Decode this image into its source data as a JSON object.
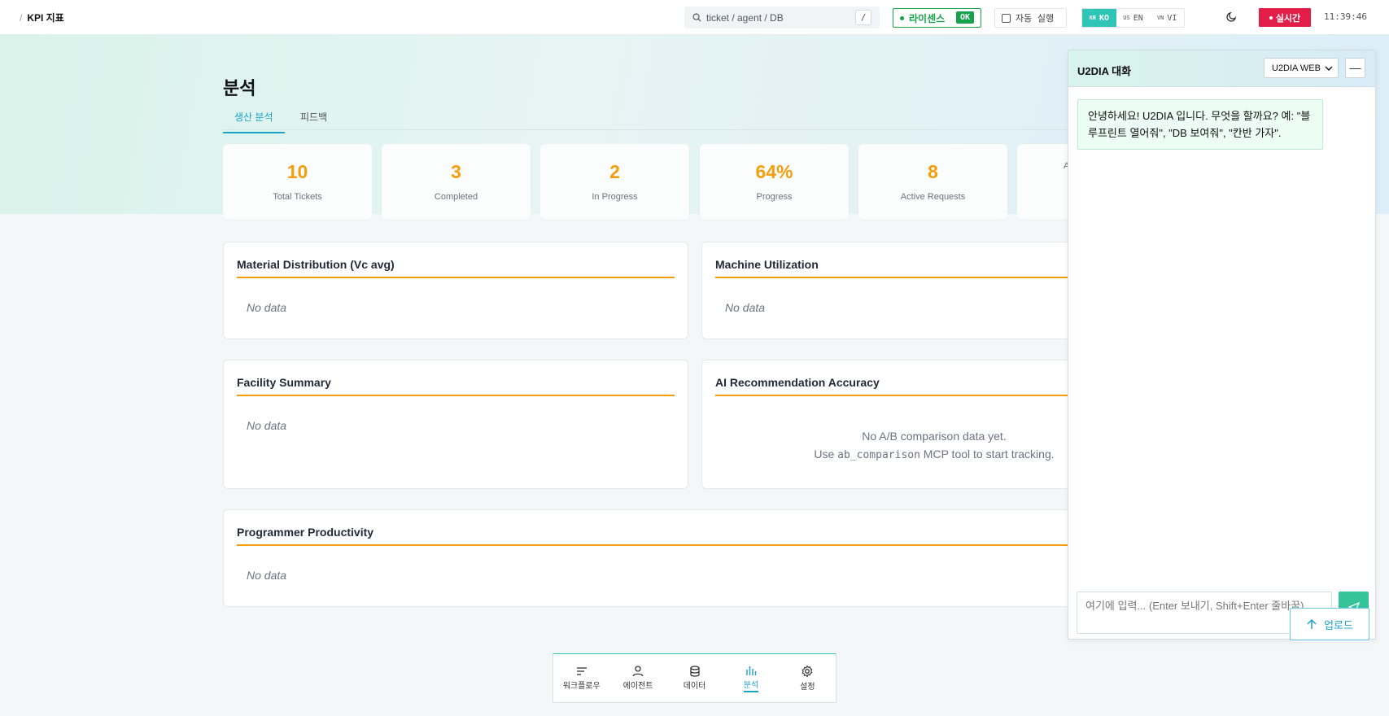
{
  "breadcrumb": {
    "separator": "/",
    "title": "KPI 지표"
  },
  "search": {
    "placeholder": "ticket / agent / DB",
    "shortcut": "/"
  },
  "license": {
    "label": "라이센스",
    "status": "OK"
  },
  "auto_run": {
    "label": "자동 실행"
  },
  "languages": [
    {
      "flag": "KR",
      "code": "KO",
      "active": true
    },
    {
      "flag": "US",
      "code": "EN",
      "active": false
    },
    {
      "flag": "VN",
      "code": "VI",
      "active": false
    }
  ],
  "live": {
    "label": "실시간"
  },
  "clock": "11:39:46",
  "page": {
    "title": "분석"
  },
  "tabs": [
    {
      "label": "생산 분석",
      "active": true
    },
    {
      "label": "피드백",
      "active": false
    }
  ],
  "kpis": [
    {
      "value": "10",
      "label": "Total Tickets"
    },
    {
      "value": "3",
      "label": "Completed"
    },
    {
      "value": "2",
      "label": "In Progress"
    },
    {
      "value": "64%",
      "label": "Progress"
    },
    {
      "value": "8",
      "label": "Active Requests"
    },
    {
      "value": "",
      "label": "A"
    }
  ],
  "cards": {
    "material": {
      "title": "Material Distribution (Vc avg)",
      "empty": "No data"
    },
    "machine": {
      "title": "Machine Utilization",
      "empty": "No data"
    },
    "facility": {
      "title": "Facility Summary",
      "empty": "No data"
    },
    "ai": {
      "title": "AI Recommendation Accuracy",
      "line1": "No A/B comparison data yet.",
      "line2_pre": "Use ",
      "line2_code": "ab_comparison",
      "line2_post": " MCP tool to start tracking."
    },
    "programmer": {
      "title": "Programmer Productivity",
      "empty": "No data"
    }
  },
  "bottom_nav": [
    {
      "label": "워크플로우",
      "icon": "workflow-icon",
      "active": false
    },
    {
      "label": "에이전트",
      "icon": "person-icon",
      "active": false
    },
    {
      "label": "데이터",
      "icon": "database-icon",
      "active": false
    },
    {
      "label": "분석",
      "icon": "chart-icon",
      "active": true
    },
    {
      "label": "설정",
      "icon": "gear-icon",
      "active": false
    }
  ],
  "chat": {
    "title": "U2DIA 대화",
    "mode": "U2DIA WEB",
    "minimize": "—",
    "greeting": "안녕하세요! U2DIA 입니다. 무엇을 할까요? 예: \"블루프린트 열어줘\", \"DB 보여줘\", \"칸반 가자\".",
    "input_placeholder": "여기에 입력... (Enter 보내기, Shift+Enter 줄바꿈)"
  },
  "upload": {
    "label": "업로드"
  },
  "colors": {
    "accent": "#f59e0b",
    "teal": "#2ec4b6",
    "live": "#e11d48",
    "ok": "#16a34a",
    "link": "#1aa3c9"
  }
}
